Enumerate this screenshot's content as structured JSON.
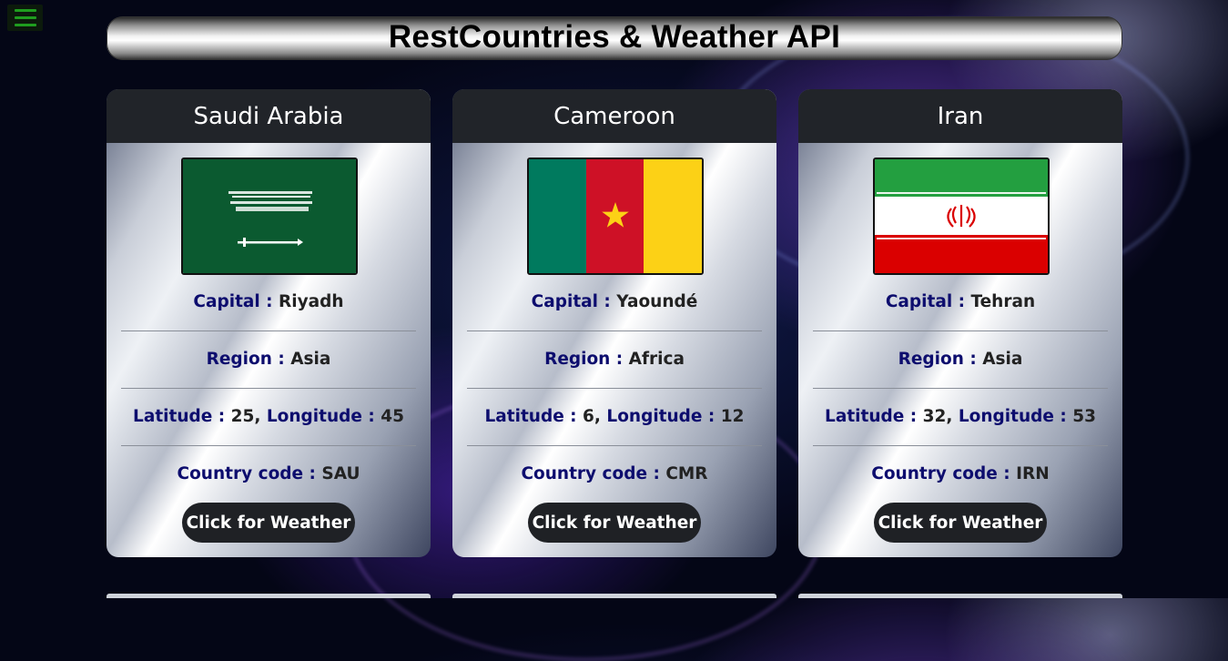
{
  "header": {
    "title": "RestCountries & Weather API"
  },
  "labels": {
    "capital": "Capital :",
    "region": "Region :",
    "latitude": "Latitude :",
    "longitude": "Longitude :",
    "country_code": "Country code :",
    "weather_button": "Click for Weather"
  },
  "cards": [
    {
      "name": "Saudi Arabia",
      "capital": "Riyadh",
      "region": "Asia",
      "latitude": "25,",
      "longitude": "45",
      "code": "SAU"
    },
    {
      "name": "Cameroon",
      "capital": "Yaoundé",
      "region": "Africa",
      "latitude": "6,",
      "longitude": "12",
      "code": "CMR"
    },
    {
      "name": "Iran",
      "capital": "Tehran",
      "region": "Asia",
      "latitude": "32,",
      "longitude": "53",
      "code": "IRN"
    }
  ],
  "colors": {
    "header_text": "#000000",
    "card_header_bg": "#212429",
    "label_color": "#0d0d6e",
    "menu_icon": "#1f9d1f"
  },
  "icons": {
    "menu": "hamburger-menu-icon"
  }
}
